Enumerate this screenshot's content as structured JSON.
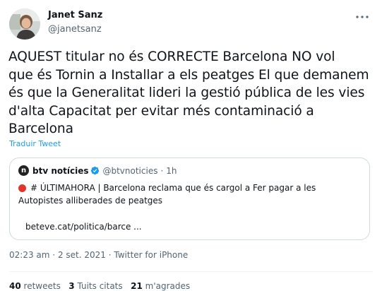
{
  "author": {
    "name": "Janet Sanz",
    "handle": "@janetsanz"
  },
  "tweet": {
    "text": "AQUEST titular no és CORRECTE Barcelona NO vol\nque és Tornin a Installar a els peatges El que demanem\nés que la Generalitat lideri la gestió pública de les vies\nd'alta Capacitat per evitar més contaminació a\nBarcelona",
    "translate_label": "Traduir Tweet"
  },
  "quote": {
    "name": "btv notícies",
    "handle": "@btvnoticies",
    "separator": "·",
    "time": "1h",
    "line1": "# ÚLTIMAHORA | Barcelona reclama que és cargol a Fer pagar a les",
    "line2": "Autopistes alliberades de peatges",
    "link": "beteve.cat/politica/barce ...",
    "logo_letter": "n"
  },
  "meta": {
    "time": "02:23 am",
    "date": "2 set. 2021",
    "separator": "·",
    "source": "Twitter for iPhone"
  },
  "stats": {
    "retweets_count": "40",
    "retweets_label": "retweets",
    "quotes_count": "3",
    "quotes_label": "Tuits citats",
    "likes_count": "21",
    "likes_label": "m'agrades"
  },
  "colors": {
    "accent": "#1d9bf0",
    "text": "#0f1419",
    "muted": "#536471",
    "border": "#cfd9de",
    "breaking": "#e0342d"
  },
  "icons": [
    "avatar",
    "more-icon",
    "verified-icon",
    "btv-logo",
    "red-circle-icon"
  ]
}
